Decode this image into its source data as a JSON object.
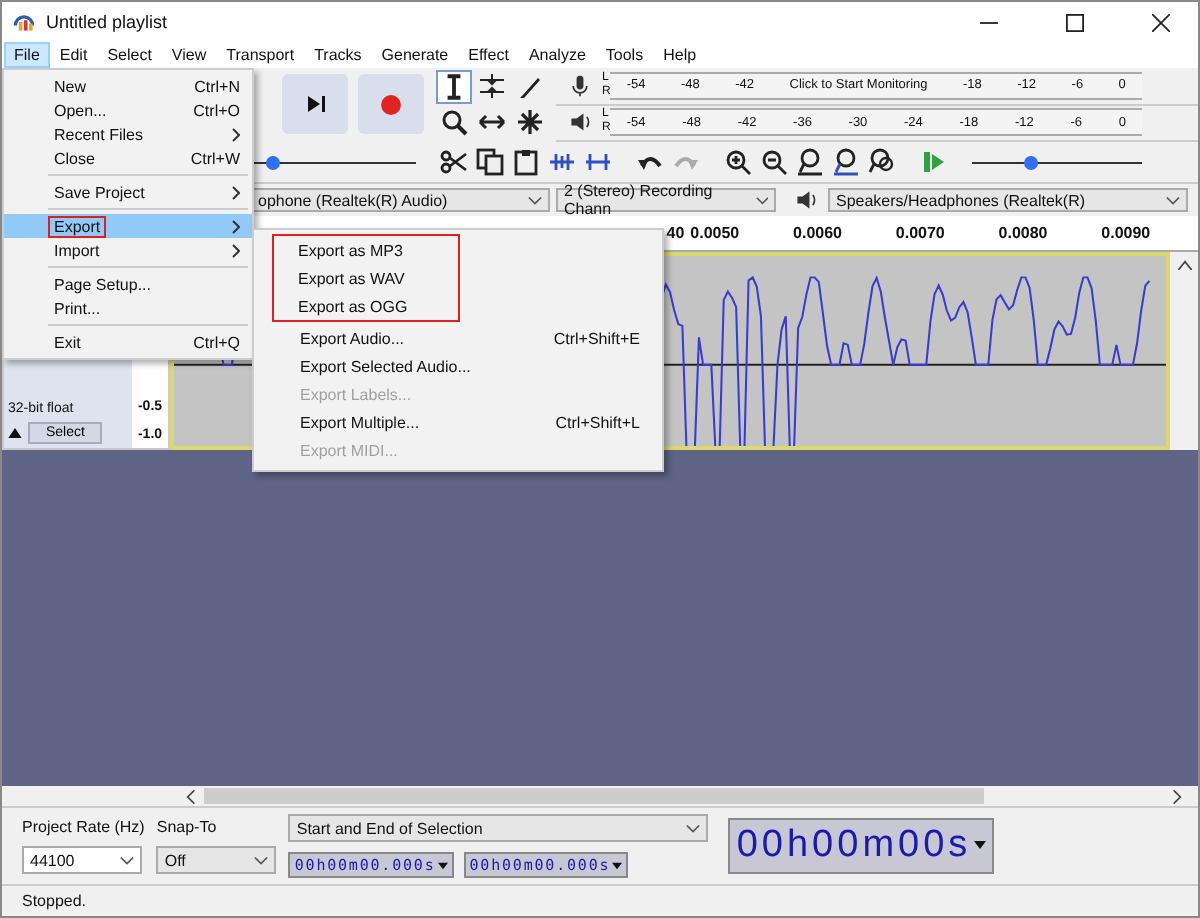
{
  "window": {
    "title": "Untitled playlist"
  },
  "menu_bar": [
    {
      "label": "File",
      "selected": true
    },
    {
      "label": "Edit",
      "selected": false
    },
    {
      "label": "Select",
      "selected": false
    },
    {
      "label": "View",
      "selected": false
    },
    {
      "label": "Transport",
      "selected": false
    },
    {
      "label": "Tracks",
      "selected": false
    },
    {
      "label": "Generate",
      "selected": false
    },
    {
      "label": "Effect",
      "selected": false
    },
    {
      "label": "Analyze",
      "selected": false
    },
    {
      "label": "Tools",
      "selected": false
    },
    {
      "label": "Help",
      "selected": false
    }
  ],
  "file_menu": [
    {
      "kind": "item",
      "label": "New",
      "shortcut": "Ctrl+N",
      "selected": false,
      "boxed": false
    },
    {
      "kind": "item",
      "label": "Open...",
      "shortcut": "Ctrl+O",
      "selected": false,
      "boxed": false
    },
    {
      "kind": "submenu",
      "label": "Recent Files",
      "selected": false,
      "boxed": false
    },
    {
      "kind": "item",
      "label": "Close",
      "shortcut": "Ctrl+W",
      "selected": false,
      "boxed": false
    },
    {
      "kind": "separator"
    },
    {
      "kind": "submenu",
      "label": "Save Project",
      "selected": false,
      "boxed": false
    },
    {
      "kind": "separator"
    },
    {
      "kind": "submenu",
      "label": "Export",
      "selected": true,
      "boxed": true
    },
    {
      "kind": "submenu",
      "label": "Import",
      "selected": false,
      "boxed": false
    },
    {
      "kind": "separator"
    },
    {
      "kind": "item",
      "label": "Page Setup...",
      "selected": false,
      "boxed": false
    },
    {
      "kind": "item",
      "label": "Print...",
      "selected": false,
      "boxed": false
    },
    {
      "kind": "separator"
    },
    {
      "kind": "item",
      "label": "Exit",
      "shortcut": "Ctrl+Q",
      "selected": false,
      "boxed": false
    }
  ],
  "export_submenu": [
    {
      "label": "Export as MP3",
      "disabled": false,
      "boxed": true
    },
    {
      "label": "Export as WAV",
      "disabled": false,
      "boxed": true
    },
    {
      "label": "Export as OGG",
      "disabled": false,
      "boxed": true
    },
    {
      "label": "Export Audio...",
      "shortcut": "Ctrl+Shift+E",
      "disabled": false,
      "boxed": false
    },
    {
      "label": "Export Selected Audio...",
      "disabled": false,
      "boxed": false
    },
    {
      "label": "Export Labels...",
      "disabled": true,
      "boxed": false
    },
    {
      "label": "Export Multiple...",
      "shortcut": "Ctrl+Shift+L",
      "disabled": false,
      "boxed": false
    },
    {
      "label": "Export MIDI...",
      "disabled": true,
      "boxed": false
    }
  ],
  "record_volume": {
    "level": 0.12
  },
  "meters": [
    {
      "kind": "record",
      "channels": [
        "L",
        "R"
      ],
      "scale": [
        "-54",
        "-48",
        "-42",
        "Click to Start Monitoring",
        "-18",
        "-12",
        "-6",
        "0"
      ]
    },
    {
      "kind": "playback",
      "channels": [
        "L",
        "R"
      ],
      "scale": [
        "-54",
        "-48",
        "-42",
        "-36",
        "-30",
        "-24",
        "-18",
        "-12",
        "-6",
        "0"
      ]
    }
  ],
  "play_speed": {
    "level": 0.35
  },
  "device_bar": {
    "recording_device": "ophone (Realtek(R) Audio)",
    "recording_channels": "2 (Stereo) Recording Chann",
    "playback_device": "Speakers/Headphones (Realtek(R)"
  },
  "ruler": {
    "labels": [
      "40",
      "0.0050",
      "0.0060",
      "0.0070",
      "0.0080",
      "0.0090"
    ]
  },
  "track": {
    "format": "32-bit float",
    "select_button": "Select",
    "scale": [
      "-0.5",
      "-1.0"
    ]
  },
  "selection_toolbar": {
    "project_rate_label": "Project Rate (Hz)",
    "project_rate": "44100",
    "snap_to_label": "Snap-To",
    "snap_to": "Off",
    "selection_mode": "Start and End of Selection",
    "start_time": "00h00m00.000s",
    "end_time": "00h00m00.000s",
    "time_display": "00h00m00s"
  },
  "status_bar": {
    "text": "Stopped."
  }
}
